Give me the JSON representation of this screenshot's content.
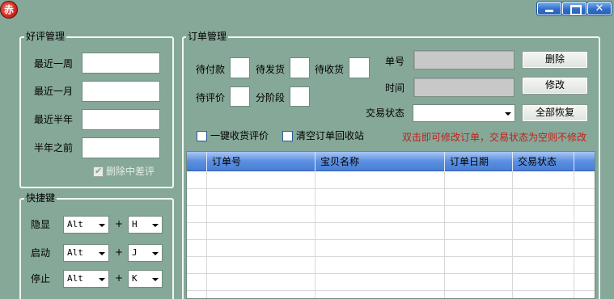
{
  "titlebar": {
    "icon_glyph": "赤",
    "close_glyph": "✕"
  },
  "review": {
    "title": "好评管理",
    "rows": [
      {
        "label": "最近一周",
        "value": ""
      },
      {
        "label": "最近一月",
        "value": ""
      },
      {
        "label": "最近半年",
        "value": ""
      },
      {
        "label": "半年之前",
        "value": ""
      }
    ],
    "delete_bad_label": "删除中差评",
    "delete_bad_checked": true
  },
  "shortcuts": {
    "title": "快捷键",
    "plus": "+",
    "rows": [
      {
        "label": "隐显",
        "mod": "Alt",
        "key": "H"
      },
      {
        "label": "启动",
        "mod": "Alt",
        "key": "J"
      },
      {
        "label": "停止",
        "mod": "Alt",
        "key": "K"
      }
    ]
  },
  "orders": {
    "title": "订单管理",
    "status_fields": [
      {
        "label": "待付款",
        "value": ""
      },
      {
        "label": "待发货",
        "value": ""
      },
      {
        "label": "待收货",
        "value": ""
      },
      {
        "label": "待评价",
        "value": ""
      },
      {
        "label": "分阶段",
        "value": ""
      }
    ],
    "order_no_label": "单号",
    "order_no_value": "",
    "time_label": "时间",
    "time_value": "",
    "trade_status_label": "交易状态",
    "trade_status_value": "",
    "delete_button": "删除",
    "modify_button": "修改",
    "restore_all_button": "全部恢复",
    "one_click_label": "一键收货评价",
    "clear_recycle_label": "清空订单回收站",
    "hint": "双击即可修改订单，交易状态为空则不修改",
    "hint_color": "#c0201a",
    "columns": [
      "订单号",
      "宝贝名称",
      "订单日期",
      "交易状态"
    ],
    "rows": []
  }
}
